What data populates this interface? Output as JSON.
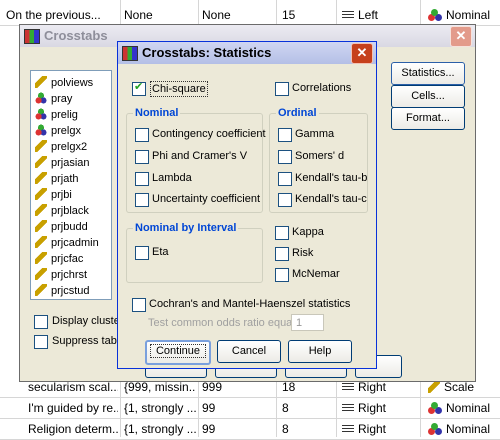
{
  "sheet": {
    "top_row": [
      "On the previous...",
      "None",
      "None",
      "15",
      "Left",
      "Nominal"
    ],
    "bottom_rows": [
      [
        "secularism scal...",
        "{999, missin...",
        "999",
        "18",
        "Right",
        "Scale"
      ],
      [
        "I'm guided by re...",
        "{1, strongly ...",
        "99",
        "8",
        "Right",
        "Nominal"
      ],
      [
        "Religion determ...",
        "{1, strongly ...",
        "99",
        "8",
        "Right",
        "Nominal"
      ]
    ]
  },
  "crosstabs": {
    "title": "Crosstabs",
    "variables": [
      "polviews",
      "pray",
      "prelig",
      "prelgx",
      "prelgx2",
      "prjasian",
      "prjath",
      "prjbi",
      "prjblack",
      "prjbudd",
      "prjcadmin",
      "prjcfac",
      "prjchrst",
      "prjcstud"
    ],
    "display_clustered": "Display clustere",
    "suppress_tables": "Suppress table",
    "buttons": {
      "statistics": "Statistics...",
      "cells": "Cells...",
      "format": "Format..."
    }
  },
  "statistics": {
    "title": "Crosstabs: Statistics",
    "chi_square": "Chi-square",
    "correlations": "Correlations",
    "nominal": {
      "title": "Nominal",
      "items": [
        "Contingency coefficient",
        "Phi and Cramer's V",
        "Lambda",
        "Uncertainty coefficient"
      ]
    },
    "ordinal": {
      "title": "Ordinal",
      "items": [
        "Gamma",
        "Somers' d",
        "Kendall's tau-b",
        "Kendall's tau-c"
      ]
    },
    "nominal_by_interval": {
      "title": "Nominal by Interval",
      "eta": "Eta"
    },
    "kappa": "Kappa",
    "risk": "Risk",
    "mcnemar": "McNemar",
    "cmh": "Cochran's and Mantel-Haenszel statistics",
    "odds_label": "Test common odds ratio equals:",
    "odds_value": "1",
    "buttons": {
      "continue": "Continue",
      "cancel": "Cancel",
      "help": "Help"
    }
  }
}
